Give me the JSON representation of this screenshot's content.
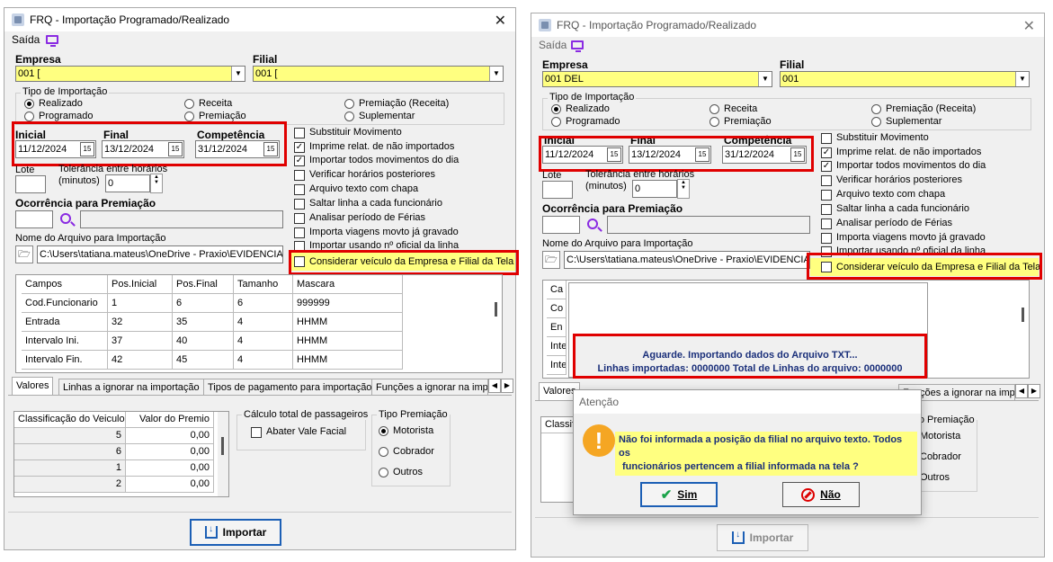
{
  "left": {
    "title": "FRQ - Importação Programado/Realizado",
    "menu_saida": "Saída",
    "empresa_label": "Empresa",
    "empresa_value": "001 [",
    "filial_label": "Filial",
    "filial_value": "001 [",
    "tipo_importacao_label": "Tipo de Importação",
    "radio_realizado": "Realizado",
    "radio_programado": "Programado",
    "radio_receita": "Receita",
    "radio_premiacao": "Premiação",
    "radio_premiacao_receita": "Premiação (Receita)",
    "radio_suplementar": "Suplementar",
    "inicial_label": "Inicial",
    "inicial_value": "11/12/2024",
    "final_label": "Final",
    "final_value": "13/12/2024",
    "competencia_label": "Competência",
    "competencia_value": "31/12/2024",
    "lote_label": "Lote",
    "tolerancia_label_1": "Tolerância entre horários",
    "tolerancia_label_2": "(minutos)",
    "tolerancia_value": "0",
    "ocorrencia_label": "Ocorrência para Premiação",
    "nome_arquivo_label": "Nome do Arquivo para Importação",
    "arquivo_path": "C:\\Users\\tatiana.mateus\\OneDrive - Praxio\\EVIDENCIA",
    "checks": [
      {
        "label": "Substituir Movimento",
        "checked": false
      },
      {
        "label": "Imprime relat. de não importados",
        "checked": true
      },
      {
        "label": "Importar todos movimentos do dia",
        "checked": true
      },
      {
        "label": "Verificar horários posteriores",
        "checked": false
      },
      {
        "label": "Arquivo texto com chapa",
        "checked": false
      },
      {
        "label": "Saltar linha a cada funcionário",
        "checked": false
      },
      {
        "label": "Analisar período de Férias",
        "checked": false
      },
      {
        "label": "Importa viagens movto já gravado",
        "checked": false
      },
      {
        "label": "Importar usando nº oficial da linha",
        "checked": false
      }
    ],
    "considerar_label": "Considerar veículo da Empresa e Filial da Tela",
    "table_headers": [
      "Campos",
      "Pos.Inicial",
      "Pos.Final",
      "Tamanho",
      "Mascara"
    ],
    "table_rows": [
      [
        "Cod.Funcionario",
        "1",
        "6",
        "6",
        "999999"
      ],
      [
        "Entrada",
        "32",
        "35",
        "4",
        "HHMM"
      ],
      [
        "Intervalo Ini.",
        "37",
        "40",
        "4",
        "HHMM"
      ],
      [
        "Intervalo Fin.",
        "42",
        "45",
        "4",
        "HHMM"
      ]
    ],
    "tabs": [
      "Valores",
      "Linhas a ignorar na importação",
      "Tipos de pagamento para importação",
      "Funções a ignorar na impo"
    ],
    "class_headers": [
      "Classificação do Veiculo",
      "Valor do Premio"
    ],
    "class_rows": [
      [
        "5",
        "0,00"
      ],
      [
        "6",
        "0,00"
      ],
      [
        "1",
        "0,00"
      ],
      [
        "2",
        "0,00"
      ]
    ],
    "calc_label": "Cálculo total de passageiros",
    "abater_label": "Abater Vale Facial",
    "tipo_premiacao_label": "Tipo Premiação",
    "radio_motorista": "Motorista",
    "radio_cobrador": "Cobrador",
    "radio_outros": "Outros",
    "importar_label": "Importar"
  },
  "right": {
    "title": "FRQ - Importação Programado/Realizado",
    "menu_saida": "Saída",
    "empresa_label": "Empresa",
    "empresa_value": "001 DEL",
    "filial_label": "Filial",
    "filial_value": "001",
    "tipo_importacao_label": "Tipo de Importação",
    "radio_realizado": "Realizado",
    "radio_programado": "Programado",
    "radio_receita": "Receita",
    "radio_premiacao": "Premiação",
    "radio_premiacao_receita": "Premiação (Receita)",
    "radio_suplementar": "Suplementar",
    "inicial_label": "Inicial",
    "inicial_value": "11/12/2024",
    "final_label": "Final",
    "final_value": "13/12/2024",
    "competencia_label": "Competência",
    "competencia_value": "31/12/2024",
    "lote_label": "Lote",
    "tolerancia_label_1": "Tolerância entre horários",
    "tolerancia_label_2": "(minutos)",
    "tolerancia_value": "0",
    "ocorrencia_label": "Ocorrência para Premiação",
    "nome_arquivo_label": "Nome do Arquivo para Importação",
    "arquivo_path": "C:\\Users\\tatiana.mateus\\OneDrive - Praxio\\EVIDENCIA",
    "checks": [
      {
        "label": "Substituir Movimento",
        "checked": false
      },
      {
        "label": "Imprime relat. de não importados",
        "checked": true
      },
      {
        "label": "Importar todos movimentos do dia",
        "checked": true
      },
      {
        "label": "Verificar horários posteriores",
        "checked": false
      },
      {
        "label": "Arquivo texto com chapa",
        "checked": false
      },
      {
        "label": "Saltar linha a cada funcionário",
        "checked": false
      },
      {
        "label": "Analisar período de Férias",
        "checked": false
      },
      {
        "label": "Importa viagens movto já gravado",
        "checked": false
      },
      {
        "label": "Importar usando nº oficial da linha",
        "checked": false
      }
    ],
    "considerar_label": "Considerar veículo da Empresa e Filial da Tela",
    "partial_rows": [
      "Ca",
      "Co",
      "En",
      "Inte",
      "Inte"
    ],
    "progress_line1": "Aguarde. Importando dados do Arquivo TXT...",
    "progress_line2": "Linhas importadas: 0000000 Total de Linhas do arquivo: 0000000",
    "tab_valores": "Valores",
    "tab_funcoes": "Funções a ignorar na impo",
    "classif_partial": "Classifi",
    "tipo_premiacao_label": "Tipo Premiação",
    "radio_motorista": "Motorista",
    "radio_cobrador": "Cobrador",
    "radio_outros": "Outros",
    "importar_label": "Importar",
    "dialog": {
      "title": "Atenção",
      "message_line1": "Não foi informada a posição da filial no arquivo texto. Todos os",
      "message_line2": "funcionários pertencem a filial informada na tela ?",
      "sim_label": "Sim",
      "nao_label": "Não"
    }
  }
}
